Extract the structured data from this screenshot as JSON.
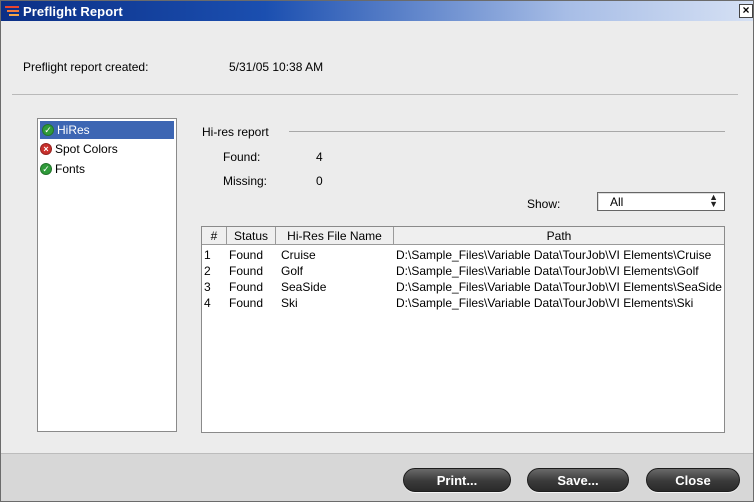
{
  "window": {
    "title": "Preflight Report"
  },
  "header": {
    "created_label": "Preflight report created:",
    "created_value": "5/31/05 10:38 AM"
  },
  "categories": [
    {
      "label": "HiRes",
      "status": "ok",
      "selected": true
    },
    {
      "label": "Spot Colors",
      "status": "error",
      "selected": false
    },
    {
      "label": "Fonts",
      "status": "ok",
      "selected": false
    }
  ],
  "report": {
    "title": "Hi-res report",
    "found_label": "Found:",
    "found_value": "4",
    "missing_label": "Missing:",
    "missing_value": "0",
    "show_label": "Show:",
    "show_value": "All"
  },
  "table": {
    "columns": [
      "#",
      "Status",
      "Hi-Res File Name",
      "Path"
    ],
    "rows": [
      [
        "1",
        "Found",
        "Cruise",
        "D:\\Sample_Files\\Variable Data\\TourJob\\VI Elements\\Cruise"
      ],
      [
        "2",
        "Found",
        "Golf",
        "D:\\Sample_Files\\Variable Data\\TourJob\\VI Elements\\Golf"
      ],
      [
        "3",
        "Found",
        "SeaSide",
        "D:\\Sample_Files\\Variable Data\\TourJob\\VI Elements\\SeaSide"
      ],
      [
        "4",
        "Found",
        "Ski",
        "D:\\Sample_Files\\Variable Data\\TourJob\\VI Elements\\Ski"
      ]
    ]
  },
  "buttons": {
    "print": "Print...",
    "save": "Save...",
    "close": "Close"
  },
  "colors": {
    "selection": "#3d66b3",
    "ok": "#2f9b3a",
    "error": "#c9302c"
  }
}
